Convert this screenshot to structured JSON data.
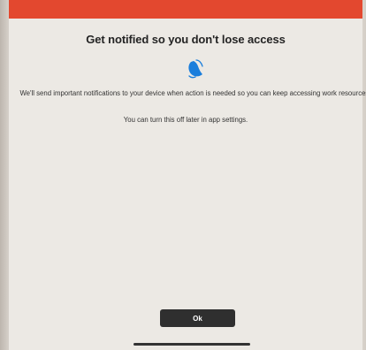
{
  "dialog": {
    "title": "Get notified so you don't lose access",
    "message_line_1": "We'll send important notifications to your device when action is needed so you can keep accessing work resources.",
    "message_line_2": "You can turn this off later in app settings.",
    "ok_label": "Ok",
    "icon": "bell-icon"
  },
  "colors": {
    "top_bar": "#e3482f",
    "bell": "#1a7edc",
    "button": "#2f2f2f"
  }
}
